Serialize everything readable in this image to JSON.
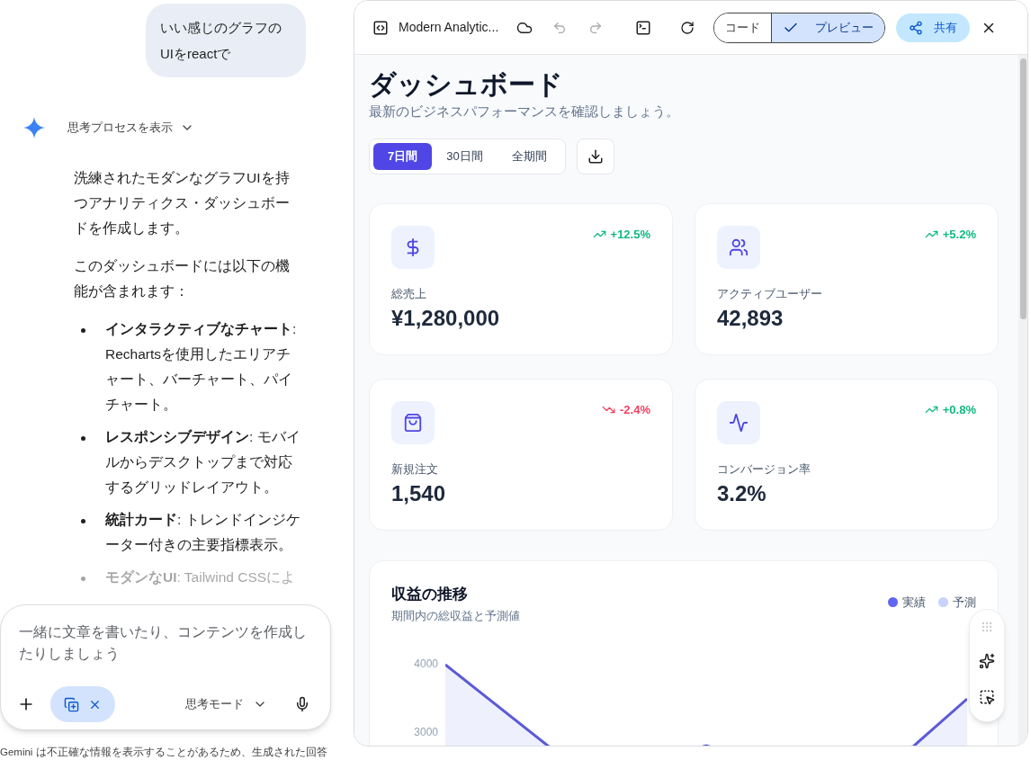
{
  "chat": {
    "user_message": "いい感じのグラフのUIをreactで",
    "thinking_toggle": "思考プロセスを表示",
    "paragraphs": [
      "洗練されたモダンなグラフUIを持つアナリティクス・ダッシュボードを作成します。",
      "このダッシュボードには以下の機能が含まれます："
    ],
    "features": [
      {
        "text": "**インタラクティブなチャート**: Rechartsを使用したエリアチャート、バーチャート、パイチャート。",
        "faded": false
      },
      {
        "text": "**レスポンシブデザイン**: モバイルからデスクトップまで対応するグリッドレイアウト。",
        "faded": false
      },
      {
        "text": "**統計カード**: トレンドインジケーター付きの主要指標表示。",
        "faded": false
      },
      {
        "text": "**モダンなUI**: Tailwind CSSによ",
        "faded": true
      }
    ],
    "input": {
      "placeholder": "一緒に文章を書いたり、コンテンツを作成したりしましょう",
      "mode": "思考モード"
    },
    "disclaimer": "Gemini は不正確な情報を表示することがあるため、生成された回答"
  },
  "artifact": {
    "title": "Modern Analytic...",
    "view_toggle": [
      {
        "label": "コード",
        "selected": false
      },
      {
        "label": "プレビュー",
        "selected": true
      }
    ],
    "share": "共有",
    "dashboard": {
      "title": "ダッシュボード",
      "subtitle": "最新のビジネスパフォーマンスを確認しましょう。",
      "periods": [
        {
          "label": "7日間",
          "selected": true
        },
        {
          "label": "30日間",
          "selected": false
        },
        {
          "label": "全期間",
          "selected": false
        }
      ],
      "stats": [
        {
          "kind": "dollar",
          "label": "総売上",
          "value": "¥1,280,000",
          "change": "+12.5%",
          "rising": true
        },
        {
          "kind": "users",
          "label": "アクティブユーザー",
          "value": "42,893",
          "change": "+5.2%",
          "rising": true
        },
        {
          "kind": "bag",
          "label": "新規注文",
          "value": "1,540",
          "change": "-2.4%",
          "rising": false
        },
        {
          "kind": "activity",
          "label": "コンバージョン率",
          "value": "3.2%",
          "change": "+0.8%",
          "rising": true
        }
      ],
      "revenue": {
        "title": "収益の推移",
        "subtitle": "期間内の総収益と予測値",
        "legend": [
          {
            "label": "実績",
            "color": "#6366f1"
          },
          {
            "label": "予測",
            "color": "#c7d2fe"
          }
        ],
        "y_labels": [
          "4000",
          "3000"
        ]
      }
    }
  }
}
